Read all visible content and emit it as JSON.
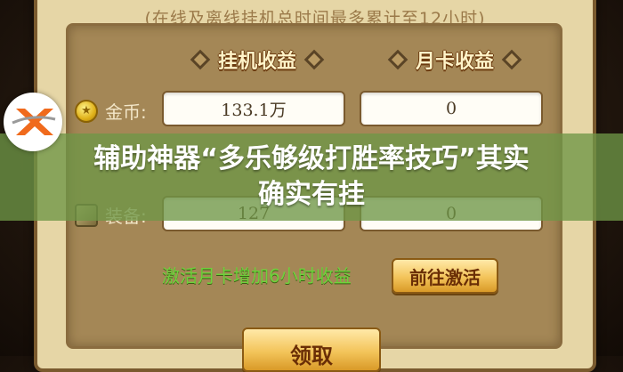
{
  "panel": {
    "note": "(在线及离线挂机总时间最多累计至12小时)"
  },
  "columns": {
    "idle_income": "挂机收益",
    "monthly_card_income": "月卡收益"
  },
  "rows": [
    {
      "label": "金币:",
      "icon": "gold-coin-icon",
      "idle_value": "133.1万",
      "card_value": "0"
    },
    {
      "label": "装备:",
      "icon": "equipment-icon",
      "idle_value": "127",
      "card_value": "0"
    }
  ],
  "activate": {
    "text": "激活月卡增加6小时收益",
    "button_label": "前往激活"
  },
  "claim_button_label": "领取",
  "banner": {
    "line1": "辅助神器“多乐够级打胜率技巧”其实",
    "line2": "确实有挂"
  },
  "colors": {
    "banner_green": "#6e9646",
    "logo_orange": "#f06a1c",
    "activate_green": "#6fd13c"
  }
}
